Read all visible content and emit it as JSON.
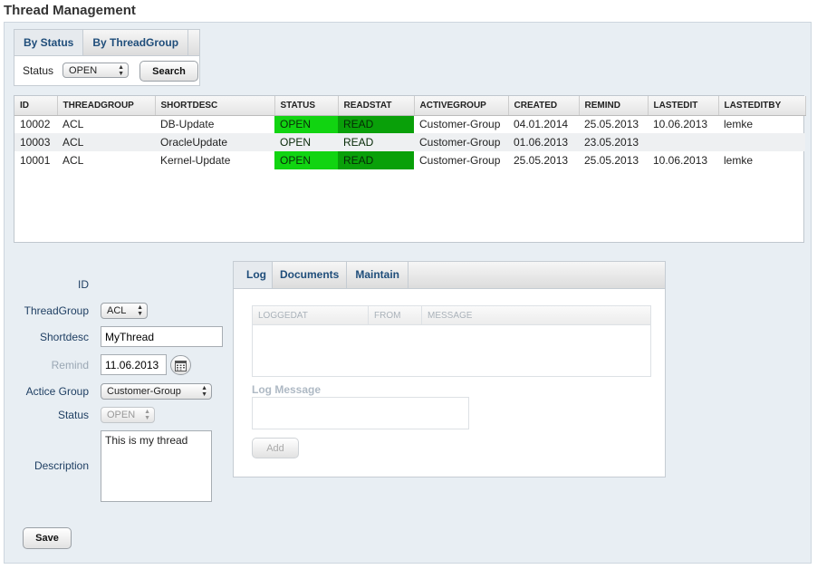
{
  "page_title": "Thread Management",
  "search": {
    "tabs": [
      {
        "label": "By Status",
        "active": true
      },
      {
        "label": "By ThreadGroup",
        "active": false
      }
    ],
    "status_label": "Status",
    "status_value": "OPEN",
    "search_button": "Search"
  },
  "table": {
    "columns": [
      "ID",
      "THREADGROUP",
      "SHORTDESC",
      "STATUS",
      "READSTAT",
      "ACTIVEGROUP",
      "CREATED",
      "REMIND",
      "LASTEDIT",
      "LASTEDITBY"
    ],
    "rows": [
      [
        "10002",
        "ACL",
        "DB-Update",
        "OPEN",
        "READ",
        "Customer-Group",
        "04.01.2014",
        "25.05.2013",
        "10.06.2013",
        "lemke"
      ],
      [
        "10003",
        "ACL",
        "OracleUpdate",
        "OPEN",
        "READ",
        "Customer-Group",
        "01.06.2013",
        "23.05.2013",
        "",
        ""
      ],
      [
        "10001",
        "ACL",
        "Kernel-Update",
        "OPEN",
        "READ",
        "Customer-Group",
        "25.05.2013",
        "25.05.2013",
        "10.06.2013",
        "lemke"
      ]
    ]
  },
  "form": {
    "id_label": "ID",
    "threadgroup_label": "ThreadGroup",
    "threadgroup_value": "ACL",
    "shortdesc_label": "Shortdesc",
    "shortdesc_value": "MyThread",
    "remind_label": "Remind",
    "remind_value": "11.06.2013",
    "activegroup_label": "Actice Group",
    "activegroup_value": "Customer-Group",
    "status_label": "Status",
    "status_value": "OPEN",
    "description_label": "Description",
    "description_value": "This is my thread",
    "save_button": "Save"
  },
  "log": {
    "tabs": [
      {
        "label": "Log",
        "active": true
      },
      {
        "label": "Documents",
        "active": false
      },
      {
        "label": "Maintain",
        "active": false
      }
    ],
    "columns": [
      "LOGGEDAT",
      "FROM",
      "MESSAGE"
    ],
    "message_label": "Log Message",
    "add_button": "Add"
  },
  "colors": {
    "status_open": "#11d411",
    "readstat_read": "#09a009",
    "label_blue": "#1f3f63"
  }
}
